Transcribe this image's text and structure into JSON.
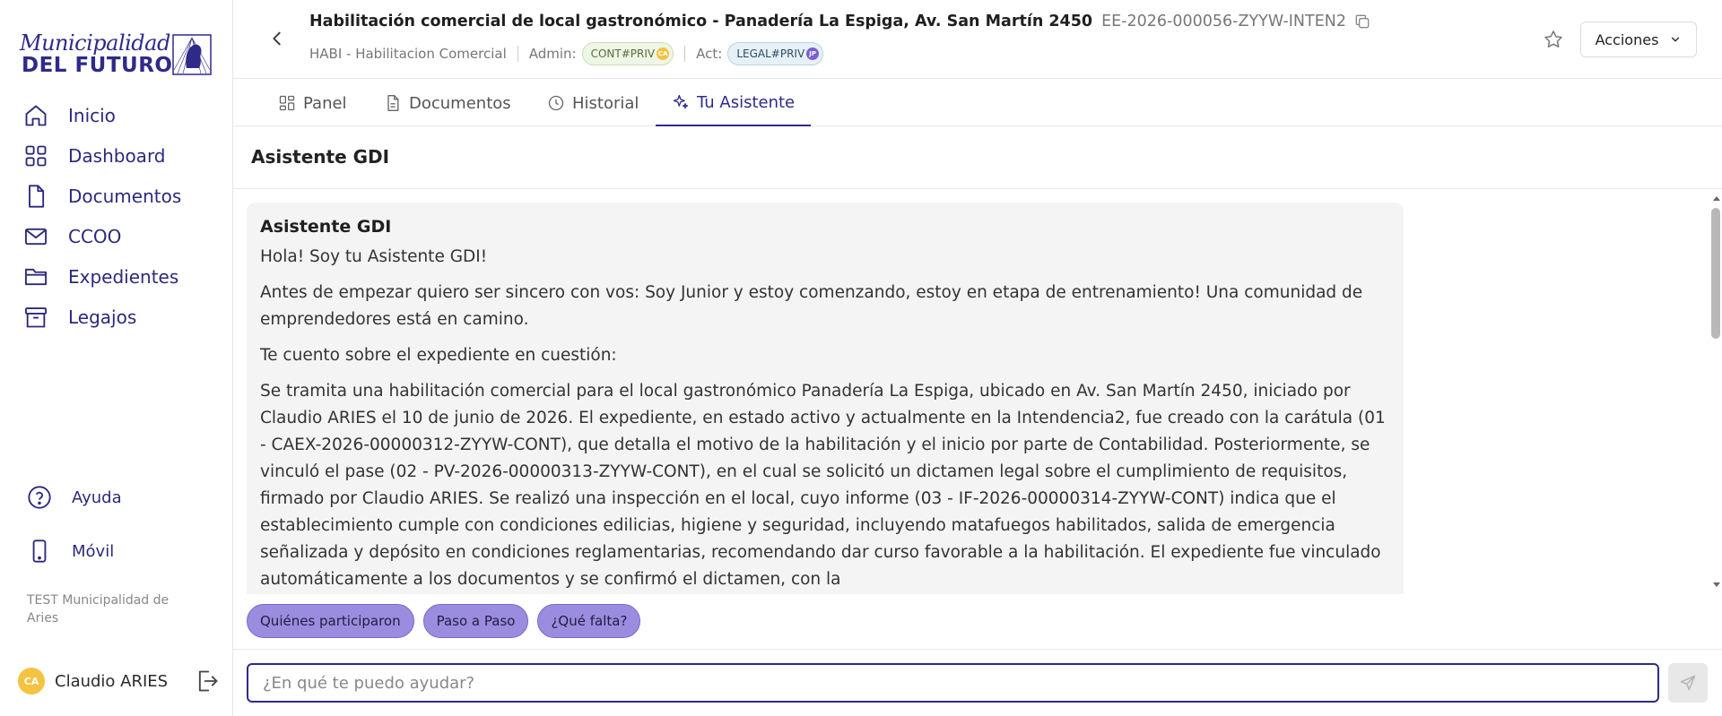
{
  "brand": {
    "script": "Municipalidad",
    "bold": "DEL FUTURO",
    "primary_color": "#2e2a8a"
  },
  "sidebar": {
    "items": [
      {
        "label": "Inicio",
        "icon": "home-icon"
      },
      {
        "label": "Dashboard",
        "icon": "dashboard-icon"
      },
      {
        "label": "Documentos",
        "icon": "document-icon"
      },
      {
        "label": "CCOO",
        "icon": "mail-icon"
      },
      {
        "label": "Expedientes",
        "icon": "folder-icon"
      },
      {
        "label": "Legajos",
        "icon": "archive-icon"
      }
    ],
    "help_label": "Ayuda",
    "mobile_label": "Móvil",
    "org": "TEST Municipalidad de Aries",
    "user": {
      "initials": "CA",
      "name": "Claudio ARIES",
      "avatar_color": "#f5c242"
    }
  },
  "header": {
    "title": "Habilitación comercial de local gastronómico - Panadería La Espiga, Av. San Martín 2450",
    "code": "EE-2026-000056-ZYYW-INTEN2",
    "type": "HABI - Habilitacion Comercial",
    "admin_label": "Admin:",
    "admin_chip": "CONT#PRIV",
    "admin_chip_badge": "CA",
    "act_label": "Act:",
    "act_chip": "LEGAL#PRIV",
    "act_chip_badge": "JP",
    "actions_label": "Acciones"
  },
  "tabs": [
    {
      "label": "Panel",
      "icon": "panel-icon"
    },
    {
      "label": "Documentos",
      "icon": "document-icon"
    },
    {
      "label": "Historial",
      "icon": "clock-icon"
    },
    {
      "label": "Tu Asistente",
      "icon": "sparkle-icon",
      "active": true
    }
  ],
  "assistant": {
    "section_title": "Asistente GDI",
    "message": {
      "title": "Asistente GDI",
      "paragraphs": [
        "Hola! Soy tu Asistente GDI!",
        "Antes de empezar quiero ser sincero con vos: Soy Junior y estoy comenzando, estoy en etapa de entrenamiento! Una comunidad de emprendedores está en camino.",
        "Te cuento sobre el expediente en cuestión:",
        "Se tramita una habilitación comercial para el local gastronómico Panadería La Espiga, ubicado en Av. San Martín 2450, iniciado por Claudio ARIES el 10 de junio de 2026. El expediente, en estado activo y actualmente en la Intendencia2, fue creado con la carátula (01 - CAEX-2026-00000312-ZYYW-CONT), que detalla el motivo de la habilitación y el inicio por parte de Contabilidad. Posteriormente, se vinculó el pase (02 - PV-2026-00000313-ZYYW-CONT), en el cual se solicitó un dictamen legal sobre el cumplimiento de requisitos, firmado por Claudio ARIES. Se realizó una inspección en el local, cuyo informe (03 - IF-2026-00000314-ZYYW-CONT) indica que el establecimiento cumple con condiciones edilicias, higiene y seguridad, incluyendo matafuegos habilitados, salida de emergencia señalizada y depósito en condiciones reglamentarias, recomendando dar curso favorable a la habilitación. El expediente fue vinculado automáticamente a los documentos y se confirmó el dictamen, con la"
      ]
    },
    "suggestions": [
      "Quiénes participaron",
      "Paso a Paso",
      "¿Qué falta?"
    ],
    "input_placeholder": "¿En qué te puedo ayudar?",
    "suggestion_color": "#9c8ce0"
  }
}
